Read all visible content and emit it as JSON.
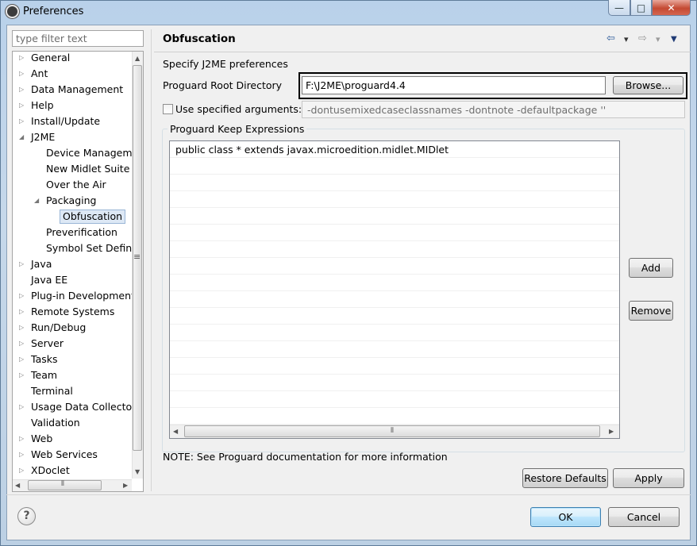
{
  "window": {
    "title": "Preferences",
    "controls": {
      "minimize": "—",
      "maximize": "□",
      "close": "✕"
    }
  },
  "sidebar": {
    "filter_placeholder": "type filter text",
    "items": [
      {
        "label": "General",
        "expander": "▷"
      },
      {
        "label": "Ant",
        "expander": "▷"
      },
      {
        "label": "Data Management",
        "expander": "▷"
      },
      {
        "label": "Help",
        "expander": "▷"
      },
      {
        "label": "Install/Update",
        "expander": "▷"
      },
      {
        "label": "J2ME",
        "expander": "◢"
      },
      {
        "label": "Device Manageme"
      },
      {
        "label": "New Midlet Suite"
      },
      {
        "label": "Over the Air"
      },
      {
        "label": "Packaging",
        "expander": "◢"
      },
      {
        "label": "Obfuscation",
        "selected": true
      },
      {
        "label": "Preverification"
      },
      {
        "label": "Symbol Set Definit"
      },
      {
        "label": "Java",
        "expander": "▷"
      },
      {
        "label": "Java EE"
      },
      {
        "label": "Plug-in Development",
        "expander": "▷"
      },
      {
        "label": "Remote Systems",
        "expander": "▷"
      },
      {
        "label": "Run/Debug",
        "expander": "▷"
      },
      {
        "label": "Server",
        "expander": "▷"
      },
      {
        "label": "Tasks",
        "expander": "▷"
      },
      {
        "label": "Team",
        "expander": "▷"
      },
      {
        "label": "Terminal"
      },
      {
        "label": "Usage Data Collector",
        "expander": "▷"
      },
      {
        "label": "Validation"
      },
      {
        "label": "Web",
        "expander": "▷"
      },
      {
        "label": "Web Services",
        "expander": "▷"
      },
      {
        "label": "XDoclet",
        "expander": "▷"
      }
    ]
  },
  "page": {
    "title": "Obfuscation",
    "nav": {
      "back": "⇦",
      "back_menu": "▾",
      "forward": "⇨",
      "forward_menu": "▾",
      "view_menu": "▼"
    },
    "intro": "Specify J2ME preferences",
    "root_dir_label": "Proguard Root Directory",
    "root_dir_value": "F:\\J2ME\\proguard4.4",
    "browse_label": "Browse...",
    "use_args_label": "Use specified arguments:",
    "use_args_checked": false,
    "args_value": "-dontusemixedcaseclassnames -dontnote -defaultpackage ''",
    "keep_group_label": "Proguard Keep Expressions",
    "keep_expressions": [
      "public class * extends javax.microedition.midlet.MIDlet"
    ],
    "add_label": "Add",
    "remove_label": "Remove",
    "note": "NOTE: See Proguard documentation for more information",
    "restore_defaults_label": "Restore Defaults",
    "apply_label": "Apply"
  },
  "footer": {
    "help_glyph": "?",
    "ok_label": "OK",
    "cancel_label": "Cancel"
  },
  "scroll": {
    "up": "▲",
    "down": "▼",
    "left": "◀",
    "right": "▶",
    "grip_v": "≡",
    "grip_h": "⦀"
  }
}
